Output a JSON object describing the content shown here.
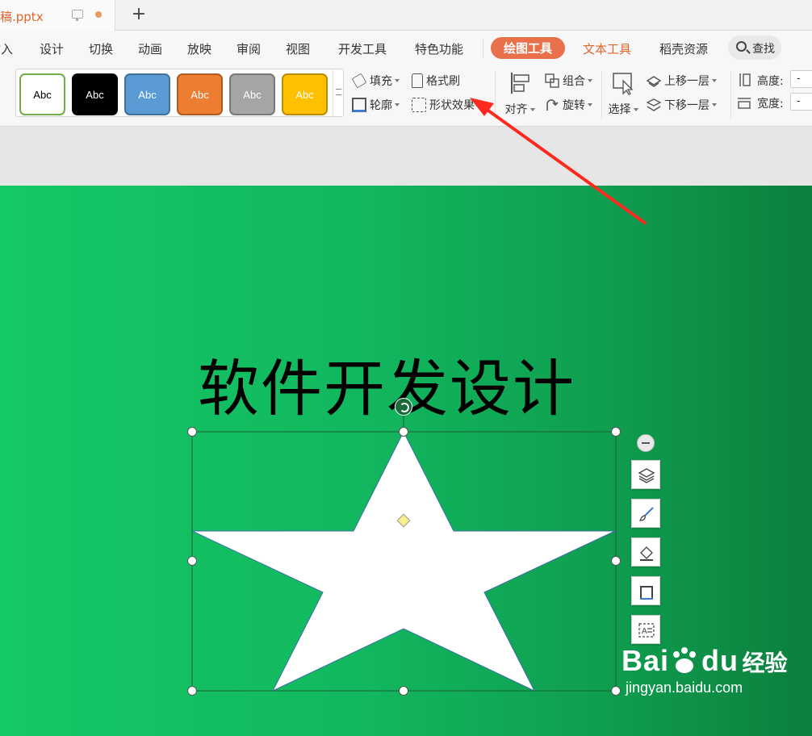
{
  "doc_tab": {
    "filename": "稿.pptx"
  },
  "menu": {
    "items": [
      "插入",
      "设计",
      "切换",
      "动画",
      "放映",
      "审阅",
      "视图",
      "开发工具",
      "特色功能",
      "绘图工具",
      "文本工具",
      "稻壳资源"
    ],
    "active": "绘图工具",
    "search_label": "查找"
  },
  "ribbon": {
    "style_presets": [
      {
        "label": "Abc",
        "bg": "#ffffff",
        "border": "#70ad47",
        "fg": "#000000"
      },
      {
        "label": "Abc",
        "bg": "#000000",
        "border": "#000000",
        "fg": "#ffffff"
      },
      {
        "label": "Abc",
        "bg": "#5b9bd5",
        "border": "#41719c",
        "fg": "#ffffff"
      },
      {
        "label": "Abc",
        "bg": "#ed7d31",
        "border": "#ae5a21",
        "fg": "#ffffff"
      },
      {
        "label": "Abc",
        "bg": "#a5a5a5",
        "border": "#787878",
        "fg": "#ffffff"
      },
      {
        "label": "Abc",
        "bg": "#ffc000",
        "border": "#bc8c00",
        "fg": "#ffffff"
      }
    ],
    "fill_label": "填充",
    "outline_label": "轮廓",
    "format_painter_label": "格式刷",
    "shape_effect_label": "形状效果",
    "align_label": "对齐",
    "group_label": "组合",
    "rotate_label": "旋转",
    "select_label": "选择",
    "bring_forward_label": "上移一层",
    "send_backward_label": "下移一层",
    "height_label": "高度:",
    "width_label": "宽度:",
    "height_value": "-",
    "width_value": "-"
  },
  "slide": {
    "title": "软件开发设计",
    "background_start": "#15c866",
    "background_end": "#0c7f3e",
    "shape": "star-5-point",
    "shape_fill": "#ffffff"
  },
  "watermark": {
    "brand_latin": "Bai",
    "brand_suffix": "du",
    "brand_cn": "经验",
    "url": "jingyan.baidu.com"
  },
  "annotation": {
    "arrow_color": "#ff2a1f"
  }
}
